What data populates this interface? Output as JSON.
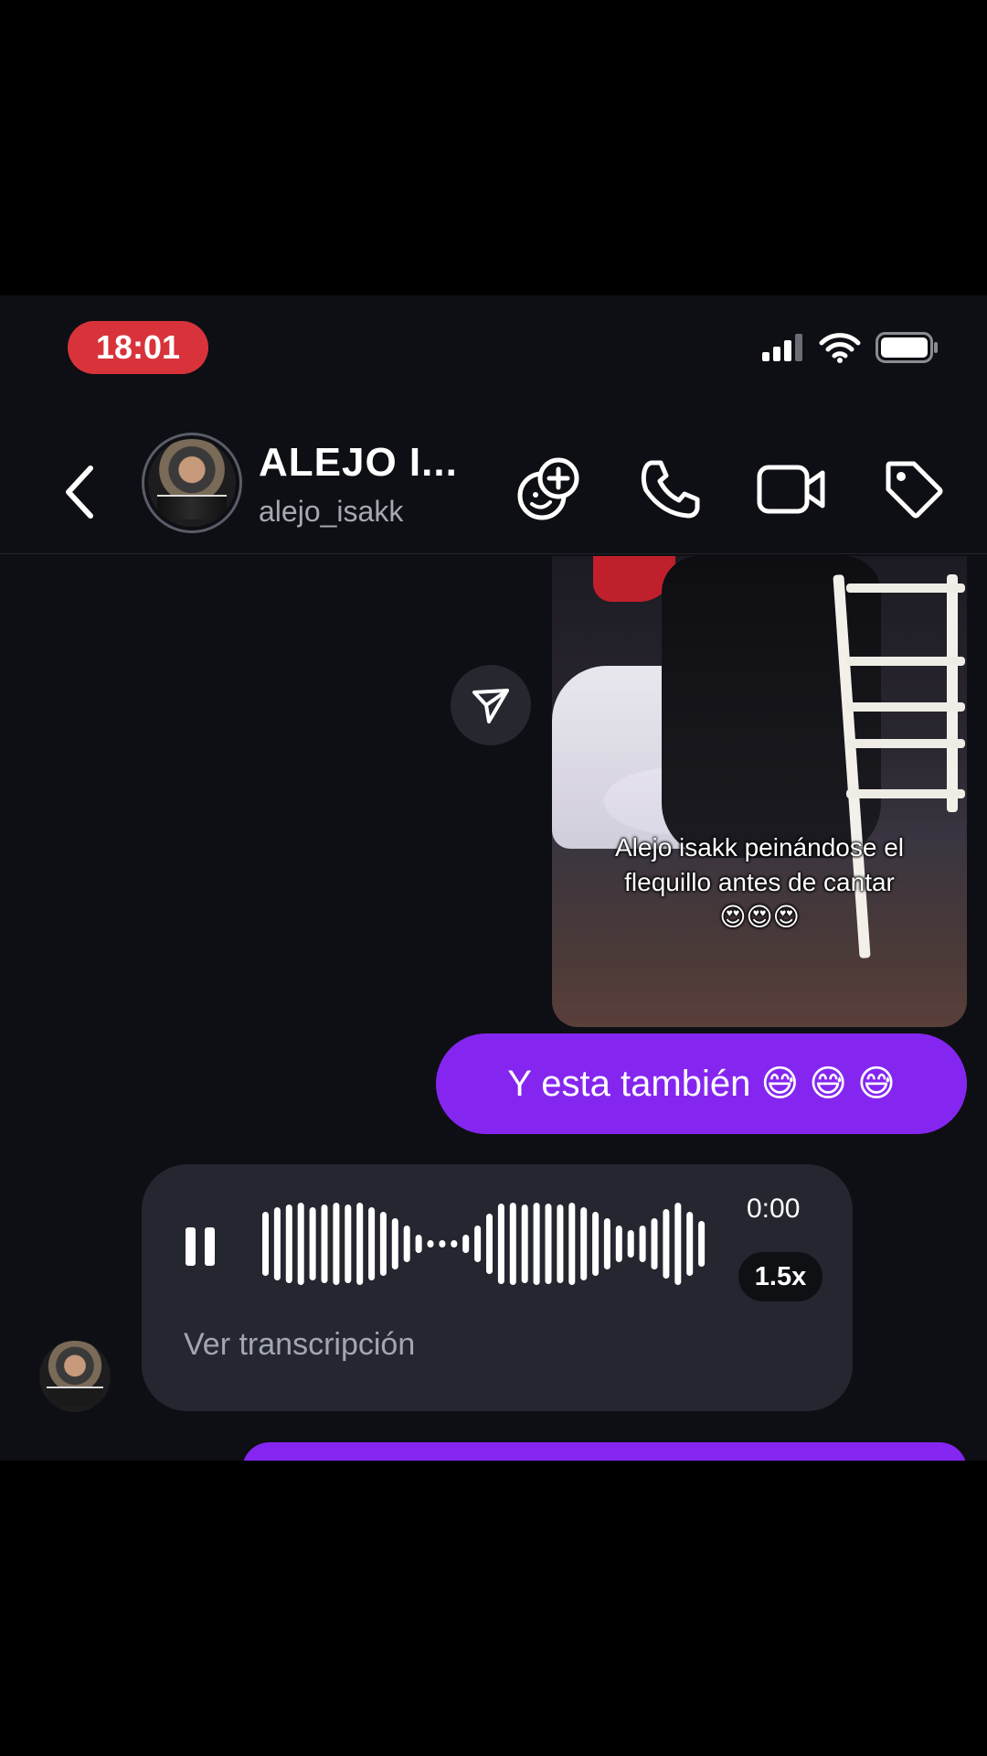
{
  "status_bar": {
    "time": "18:01",
    "icons": [
      "signal-icon",
      "wifi-icon",
      "battery-icon"
    ]
  },
  "header": {
    "back_icon": "chevron-left-icon",
    "contact_name": "ALEJO I...",
    "contact_handle": "alejo_isakk",
    "actions": [
      "add-effect-icon",
      "phone-icon",
      "video-icon",
      "tag-icon"
    ]
  },
  "messages": {
    "media": {
      "caption_line1": "Alejo isakk peinándose el",
      "caption_line2": "flequillo antes de cantar",
      "caption_emoji": "😍😍😍",
      "share_icon": "send-icon"
    },
    "sent_text": "Y esta también 😅 😅 😅",
    "voice": {
      "duration": "0:00",
      "speed": "1.5x",
      "transcription_label": "Ver transcripción",
      "control_icon": "pause-icon"
    }
  },
  "colors": {
    "background": "#0e0f14",
    "sent_bubble": "#8526f0",
    "received_bubble": "#252730",
    "time_pill": "#d8333b"
  }
}
